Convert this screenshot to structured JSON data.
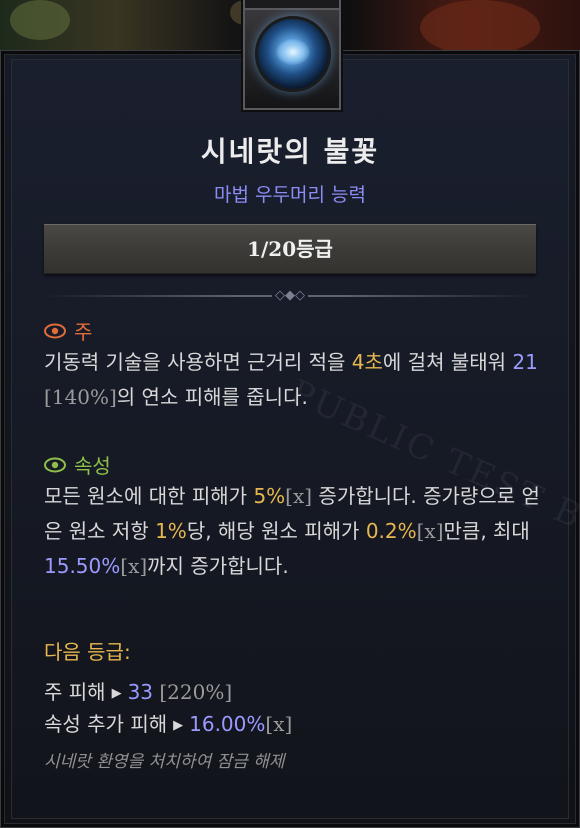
{
  "skill": {
    "name": "시네랏의 불꽃",
    "category": "마법 우두머리 능력",
    "rank": "1/20등급"
  },
  "main": {
    "label": "주",
    "text_a": "기동력 기술을 사용하면 근거리 적을 ",
    "duration": "4초",
    "text_b": "에 걸쳐 불태워 ",
    "damage": "21",
    "damage_scale": "[140%]",
    "text_c": "의 연소 피해를 줍니다."
  },
  "attribute": {
    "label": "속성",
    "text_a": "모든 원소에 대한 피해가 ",
    "dmg_bonus": "5%",
    "x1": "[x]",
    "text_b": " 증가합니다. 증가량으로 얻은 원소 저항 ",
    "resist": "1%",
    "text_c": "당, 해당 원소 피해가 ",
    "per_resist": "0.2%",
    "x2": "[x]",
    "text_d": "만큼, 최대 ",
    "cap": "15.50%",
    "x3": "[x]",
    "text_e": "까지 증가합니다."
  },
  "next_rank": {
    "label": "다음 등급:",
    "line1_label": "주 피해",
    "line1_value": "33",
    "line1_scale": "[220%]",
    "line2_label": "속성 추가 피해",
    "line2_value": "16.00%",
    "line2_x": "[x]"
  },
  "unlock_text": "시네랏 환영을 처치하여 잠금 해제",
  "watermark": "PUBLIC TEST BUILD",
  "colors": {
    "title": "#ececec",
    "category": "#8c8cf5",
    "main_label": "#e06c3a",
    "attr_label": "#8fbf4a",
    "highlight_gold": "#e7b74f",
    "highlight_blue": "#9a9aff"
  },
  "icons": {
    "skill": "blue-flame-orb-icon",
    "main": "eye-icon",
    "attribute": "eye-icon",
    "arrow": "triangle-right-icon"
  }
}
